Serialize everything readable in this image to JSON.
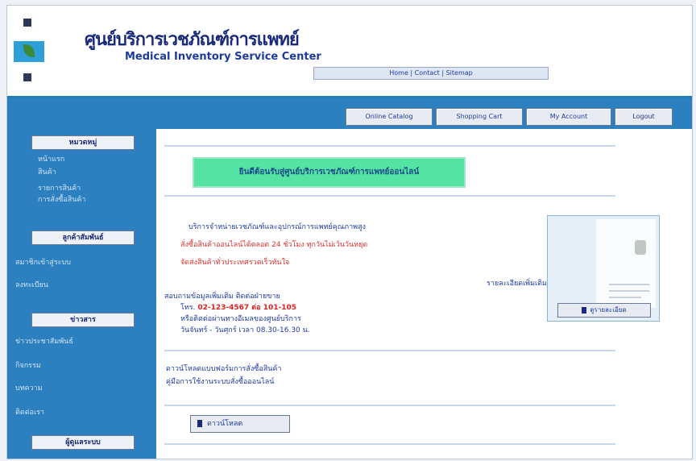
{
  "header": {
    "title_th": "ศูนย์บริการเวชภัณฑ์การแพทย์",
    "title_en": "Medical Inventory Service Center",
    "nav_strip": "Home | Contact | Sitemap"
  },
  "topnav": [
    {
      "label": "Online Catalog"
    },
    {
      "label": "Shopping Cart"
    },
    {
      "label": "My Account"
    },
    {
      "label": "Logout"
    }
  ],
  "sidebar": {
    "sections": [
      {
        "title": "หมวดหมู่",
        "items": [
          "หน้าแรก",
          "สินค้า",
          "รายการสินค้า",
          "การสั่งซื้อสินค้า"
        ]
      },
      {
        "title": "ลูกค้าสัมพันธ์",
        "items": [
          "สมาชิกเข้าสู่ระบบ",
          "ลงทะเบียน"
        ]
      },
      {
        "title": "ข่าวสาร",
        "items": [
          "ข่าวประชาสัมพันธ์",
          "กิจกรรม",
          "บทความ",
          "ติดต่อเรา"
        ]
      },
      {
        "title": "ผู้ดูแลระบบ",
        "items": []
      }
    ]
  },
  "main": {
    "banner": "ยินดีต้อนรับสู่ศูนย์บริการเวชภัณฑ์การแพทย์ออนไลน์",
    "intro": "บริการจำหน่ายเวชภัณฑ์และอุปกรณ์การแพทย์คุณภาพสูง",
    "red_line_1": "สั่งซื้อสินค้าออนไลน์ได้ตลอด 24 ชั่วโมง ทุกวันไม่เว้นวันหยุด",
    "red_line_2": "จัดส่งสินค้าทั่วประเทศรวดเร็วทันใจ",
    "detail_link": "รายละเอียดเพิ่มเติม",
    "info_heading": "สอบถามข้อมูลเพิ่มเติม ติดต่อฝ่ายขาย",
    "info_phone_label": "โทร.",
    "info_phone_value": "02-123-4567 ต่อ 101-105",
    "info_line_3": "หรือติดต่อผ่านทางอีเมลของศูนย์บริการ",
    "info_line_4": "วันจันทร์ - วันศุกร์ เวลา 08.30-16.30 น.",
    "link_1": "ดาวน์โหลดแบบฟอร์มการสั่งซื้อสินค้า",
    "link_2": "คู่มือการใช้งานระบบสั่งซื้อออนไลน์",
    "thumb_button": "ดูรายละเอียด",
    "bottom_button": "ดาวน์โหลด"
  }
}
